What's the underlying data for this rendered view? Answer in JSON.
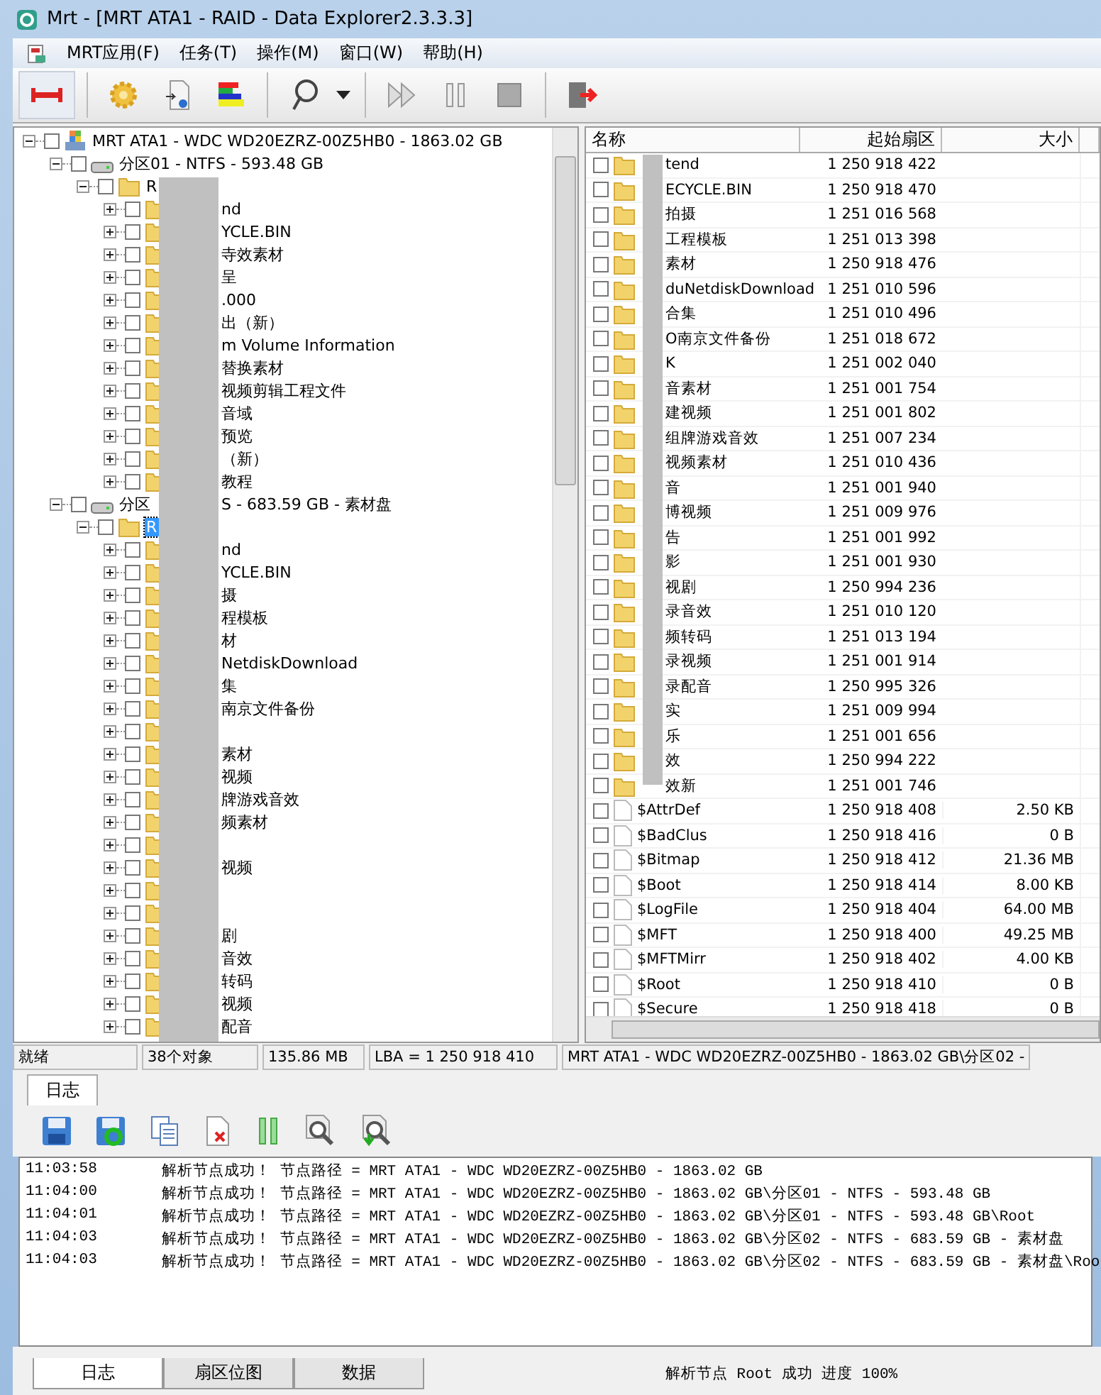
{
  "window": {
    "title": "Mrt - [MRT ATA1 - RAID - Data Explorer2.3.3.3]"
  },
  "menu": [
    "MRT应用(F)",
    "任务(T)",
    "操作(M)",
    "窗口(W)",
    "帮助(H)"
  ],
  "tree": [
    {
      "label": "MRT ATA1 - WDC WD20EZRZ-00Z5HB0 - 1863.02 GB",
      "kind": "disk",
      "expanded": true,
      "checked": false,
      "selected": false,
      "children": [
        {
          "label": "分区01 - NTFS - 593.48 GB",
          "kind": "partition",
          "expanded": true,
          "checked": false,
          "selected": false,
          "children": [
            {
              "label": "R",
              "kind": "folder",
              "expanded": true,
              "checked": false,
              "selected": false,
              "children": [
                {
                  "label_end": "nd",
                  "kind": "folder",
                  "expanded": false,
                  "checked": false,
                  "selected": false
                },
                {
                  "label_end": "YCLE.BIN",
                  "kind": "folder",
                  "expanded": false,
                  "checked": false,
                  "selected": false
                },
                {
                  "label_end": "寺效素材",
                  "kind": "folder",
                  "expanded": false,
                  "checked": false,
                  "selected": false
                },
                {
                  "label_end": "呈",
                  "kind": "folder",
                  "expanded": false,
                  "checked": false,
                  "selected": false
                },
                {
                  "label_end": ".000",
                  "kind": "folder",
                  "expanded": false,
                  "checked": false,
                  "selected": false
                },
                {
                  "label_end": "出（新）",
                  "kind": "folder",
                  "expanded": false,
                  "checked": false,
                  "selected": false
                },
                {
                  "label_end": "m Volume Information",
                  "kind": "folder",
                  "expanded": false,
                  "checked": false,
                  "selected": false
                },
                {
                  "label_end": "替换素材",
                  "kind": "folder",
                  "expanded": false,
                  "checked": false,
                  "selected": false
                },
                {
                  "label_end": "视频剪辑工程文件",
                  "kind": "folder",
                  "expanded": false,
                  "checked": false,
                  "selected": false
                },
                {
                  "label_end": "音域",
                  "kind": "folder",
                  "expanded": false,
                  "checked": false,
                  "selected": false
                },
                {
                  "label_end": "预览",
                  "kind": "folder",
                  "expanded": false,
                  "checked": false,
                  "selected": false
                },
                {
                  "label_end": "（新）",
                  "kind": "folder",
                  "expanded": false,
                  "checked": false,
                  "selected": false
                },
                {
                  "label_end": "教程",
                  "kind": "folder",
                  "expanded": false,
                  "checked": false,
                  "selected": false
                }
              ]
            }
          ]
        },
        {
          "label": "分区",
          "label_end": "S - 683.59 GB - 素材盘",
          "kind": "partition",
          "expanded": true,
          "checked": false,
          "selected": false,
          "children": [
            {
              "label": "R",
              "kind": "folder",
              "expanded": true,
              "checked": false,
              "selected": true,
              "children": [
                {
                  "label_end": "nd",
                  "kind": "folder",
                  "expanded": false,
                  "checked": false,
                  "selected": false
                },
                {
                  "label_end": "YCLE.BIN",
                  "kind": "folder",
                  "expanded": false,
                  "checked": false,
                  "selected": false
                },
                {
                  "label_end": "摄",
                  "kind": "folder",
                  "expanded": false,
                  "checked": false,
                  "selected": false
                },
                {
                  "label_end": "程模板",
                  "kind": "folder",
                  "expanded": false,
                  "checked": false,
                  "selected": false
                },
                {
                  "label_end": "材",
                  "kind": "folder",
                  "expanded": false,
                  "checked": false,
                  "selected": false
                },
                {
                  "label_end": "NetdiskDownload",
                  "kind": "folder",
                  "expanded": false,
                  "checked": false,
                  "selected": false
                },
                {
                  "label_end": "集",
                  "kind": "folder",
                  "expanded": false,
                  "checked": false,
                  "selected": false
                },
                {
                  "label_end": "南京文件备份",
                  "kind": "folder",
                  "expanded": false,
                  "checked": false,
                  "selected": false
                },
                {
                  "kind": "folder",
                  "expanded": false,
                  "checked": false,
                  "selected": false
                },
                {
                  "label_end": "素材",
                  "kind": "folder",
                  "expanded": false,
                  "checked": false,
                  "selected": false
                },
                {
                  "label_end": "视频",
                  "kind": "folder",
                  "expanded": false,
                  "checked": false,
                  "selected": false
                },
                {
                  "label_end": "牌游戏音效",
                  "kind": "folder",
                  "expanded": false,
                  "checked": false,
                  "selected": false
                },
                {
                  "label_end": "频素材",
                  "kind": "folder",
                  "expanded": false,
                  "checked": false,
                  "selected": false
                },
                {
                  "kind": "folder",
                  "expanded": false,
                  "checked": false,
                  "selected": false
                },
                {
                  "label_end": "视频",
                  "kind": "folder",
                  "expanded": false,
                  "checked": false,
                  "selected": false
                },
                {
                  "kind": "folder",
                  "expanded": false,
                  "checked": false,
                  "selected": false
                },
                {
                  "kind": "folder",
                  "expanded": false,
                  "checked": false,
                  "selected": false
                },
                {
                  "label_end": "剧",
                  "kind": "folder",
                  "expanded": false,
                  "checked": false,
                  "selected": false
                },
                {
                  "label_end": "音效",
                  "kind": "folder",
                  "expanded": false,
                  "checked": false,
                  "selected": false
                },
                {
                  "label_end": "转码",
                  "kind": "folder",
                  "expanded": false,
                  "checked": false,
                  "selected": false
                },
                {
                  "label_end": "视频",
                  "kind": "folder",
                  "expanded": false,
                  "checked": false,
                  "selected": false
                },
                {
                  "label_end": "配音",
                  "kind": "folder",
                  "expanded": false,
                  "checked": false,
                  "selected": false
                }
              ]
            }
          ]
        }
      ]
    }
  ],
  "table": {
    "columns": [
      "名称",
      "起始扇区",
      "大小"
    ],
    "rows": [
      {
        "kind": "folder",
        "name": "tend",
        "sector": "1 250 918 422",
        "checked": false
      },
      {
        "kind": "folder",
        "name": "ECYCLE.BIN",
        "sector": "1 250 918 470",
        "checked": false
      },
      {
        "kind": "folder",
        "name": "拍摄",
        "sector": "1 251 016 568",
        "checked": false
      },
      {
        "kind": "folder",
        "name": "工程模板",
        "sector": "1 251 013 398",
        "checked": false
      },
      {
        "kind": "folder",
        "name": "素材",
        "sector": "1 250 918 476",
        "checked": false
      },
      {
        "kind": "folder",
        "name": "duNetdiskDownload",
        "sector": "1 251 010 596",
        "checked": false
      },
      {
        "kind": "folder",
        "name": "合集",
        "sector": "1 251 010 496",
        "checked": false
      },
      {
        "kind": "folder",
        "name": "O南京文件备份",
        "sector": "1 251 018 672",
        "checked": false
      },
      {
        "kind": "folder",
        "name": "K",
        "sector": "1 251 002 040",
        "checked": false
      },
      {
        "kind": "folder",
        "name": "音素材",
        "sector": "1 251 001 754",
        "checked": false
      },
      {
        "kind": "folder",
        "name": "建视频",
        "sector": "1 251 001 802",
        "checked": false
      },
      {
        "kind": "folder",
        "name": "组牌游戏音效",
        "sector": "1 251 007 234",
        "checked": false
      },
      {
        "kind": "folder",
        "name": "视频素材",
        "sector": "1 251 010 436",
        "checked": false
      },
      {
        "kind": "folder",
        "name": "音",
        "sector": "1 251 001 940",
        "checked": false
      },
      {
        "kind": "folder",
        "name": "博视频",
        "sector": "1 251 009 976",
        "checked": false
      },
      {
        "kind": "folder",
        "name": "告",
        "sector": "1 251 001 992",
        "checked": false
      },
      {
        "kind": "folder",
        "name": "影",
        "sector": "1 251 001 930",
        "checked": false
      },
      {
        "kind": "folder",
        "name": "视剧",
        "sector": "1 250 994 236",
        "checked": false
      },
      {
        "kind": "folder",
        "name": "录音效",
        "sector": "1 251 010 120",
        "checked": false
      },
      {
        "kind": "folder",
        "name": "频转码",
        "sector": "1 251 013 194",
        "checked": false
      },
      {
        "kind": "folder",
        "name": "录视频",
        "sector": "1 251 001 914",
        "checked": false
      },
      {
        "kind": "folder",
        "name": "录配音",
        "sector": "1 250 995 326",
        "checked": false
      },
      {
        "kind": "folder",
        "name": "实",
        "sector": "1 251 009 994",
        "checked": false
      },
      {
        "kind": "folder",
        "name": "乐",
        "sector": "1 251 001 656",
        "checked": false
      },
      {
        "kind": "folder",
        "name": "效",
        "sector": "1 250 994 222",
        "checked": false
      },
      {
        "kind": "folder",
        "name": "效新",
        "sector": "1 251 001 746",
        "checked": false
      },
      {
        "kind": "file",
        "name": "$AttrDef",
        "sector": "1 250 918 408",
        "size": "2.50 KB",
        "checked": false
      },
      {
        "kind": "file",
        "name": "$BadClus",
        "sector": "1 250 918 416",
        "size": "0 B",
        "checked": false
      },
      {
        "kind": "file",
        "name": "$Bitmap",
        "sector": "1 250 918 412",
        "size": "21.36 MB",
        "checked": false
      },
      {
        "kind": "file",
        "name": "$Boot",
        "sector": "1 250 918 414",
        "size": "8.00 KB",
        "checked": false
      },
      {
        "kind": "file",
        "name": "$LogFile",
        "sector": "1 250 918 404",
        "size": "64.00 MB",
        "checked": false
      },
      {
        "kind": "file",
        "name": "$MFT",
        "sector": "1 250 918 400",
        "size": "49.25 MB",
        "checked": false
      },
      {
        "kind": "file",
        "name": "$MFTMirr",
        "sector": "1 250 918 402",
        "size": "4.00 KB",
        "checked": false
      },
      {
        "kind": "file",
        "name": "$Root",
        "sector": "1 250 918 410",
        "size": "0 B",
        "checked": false
      },
      {
        "kind": "file",
        "name": "$Secure",
        "sector": "1 250 918 418",
        "size": "0 B",
        "checked": false
      }
    ]
  },
  "status_bar": [
    "就绪",
    "38个对象",
    "135.86 MB",
    "LBA = 1 250 918 410",
    "MRT ATA1 - WDC WD20EZRZ-00Z5HB0 - 1863.02 GB\\分区02 -"
  ],
  "log_tab": "日志",
  "log": [
    {
      "time": "11:03:58",
      "text": "解析节点成功！ 节点路径 = MRT ATA1 - WDC WD20EZRZ-00Z5HB0 - 1863.02 GB"
    },
    {
      "time": "11:04:00",
      "text": "解析节点成功！ 节点路径 = MRT ATA1 - WDC WD20EZRZ-00Z5HB0 - 1863.02 GB\\分区01 - NTFS - 593.48 GB"
    },
    {
      "time": "11:04:01",
      "text": "解析节点成功！ 节点路径 = MRT ATA1 - WDC WD20EZRZ-00Z5HB0 - 1863.02 GB\\分区01 - NTFS - 593.48 GB\\Root"
    },
    {
      "time": "11:04:03",
      "text": "解析节点成功！ 节点路径 = MRT ATA1 - WDC WD20EZRZ-00Z5HB0 - 1863.02 GB\\分区02 - NTFS - 683.59 GB - 素材盘"
    },
    {
      "time": "11:04:03",
      "text": "解析节点成功！ 节点路径 = MRT ATA1 - WDC WD20EZRZ-00Z5HB0 - 1863.02 GB\\分区02 - NTFS - 683.59 GB - 素材盘\\Roo"
    }
  ],
  "bottom_tabs": [
    {
      "label": "日志",
      "selected": true
    },
    {
      "label": "扇区位图",
      "selected": false
    },
    {
      "label": "数据",
      "selected": false
    }
  ],
  "bottom_status": "解析节点 Root 成功 进度 100%"
}
